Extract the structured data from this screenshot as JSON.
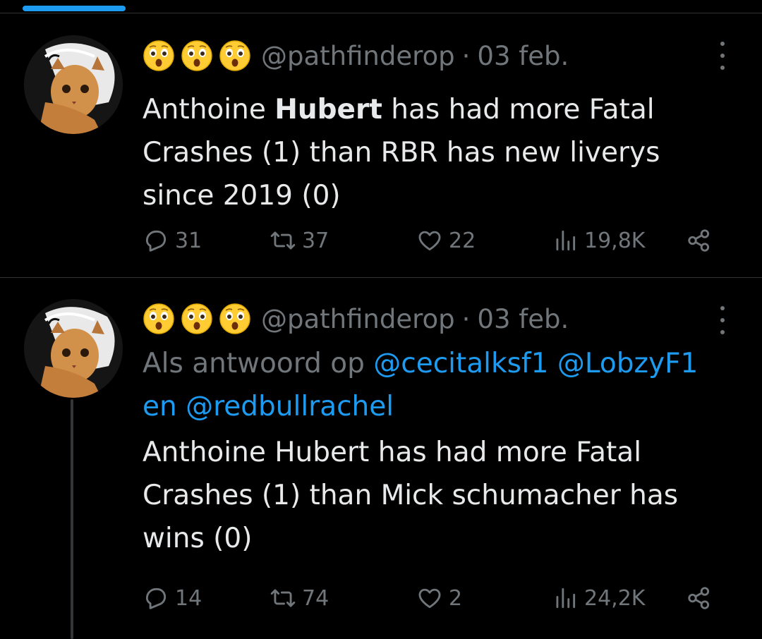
{
  "colors": {
    "background": "#000000",
    "text": "#e7e9ea",
    "muted": "#71767b",
    "accent": "#1d9bf0"
  },
  "tweets": [
    {
      "display_name_icons": [
        "astonished-face-emoji",
        "astonished-face-emoji",
        "astonished-face-emoji"
      ],
      "handle": "@pathfinderop",
      "separator": "·",
      "date": "03 feb.",
      "text_lines": [
        {
          "normal": "Anthoine ",
          "bold": "Hubert",
          "rest": " has had more Fatal"
        },
        {
          "text": "Crashes (1) than RBR has new liverys"
        },
        {
          "text": "since 2019 (0)"
        }
      ],
      "stats": {
        "replies": "31",
        "retweets": "37",
        "likes": "22",
        "views": "19,8K"
      }
    },
    {
      "display_name_icons": [
        "astonished-face-emoji",
        "astonished-face-emoji",
        "astonished-face-emoji"
      ],
      "handle": "@pathfinderop",
      "separator": "·",
      "date": "03 feb.",
      "reply_to": {
        "prefix": "Als antwoord op ",
        "mention_1": "@cecitalksf1",
        "mention_2": "@LobzyF1",
        "joiner": "en ",
        "mention_3": "@redbullrachel"
      },
      "text_lines": [
        "Anthoine Hubert has had more Fatal",
        "Crashes (1) than Mick schumacher has",
        "wins (0)"
      ],
      "stats": {
        "replies": "14",
        "retweets": "74",
        "likes": "2",
        "views": "24,2K"
      }
    }
  ]
}
